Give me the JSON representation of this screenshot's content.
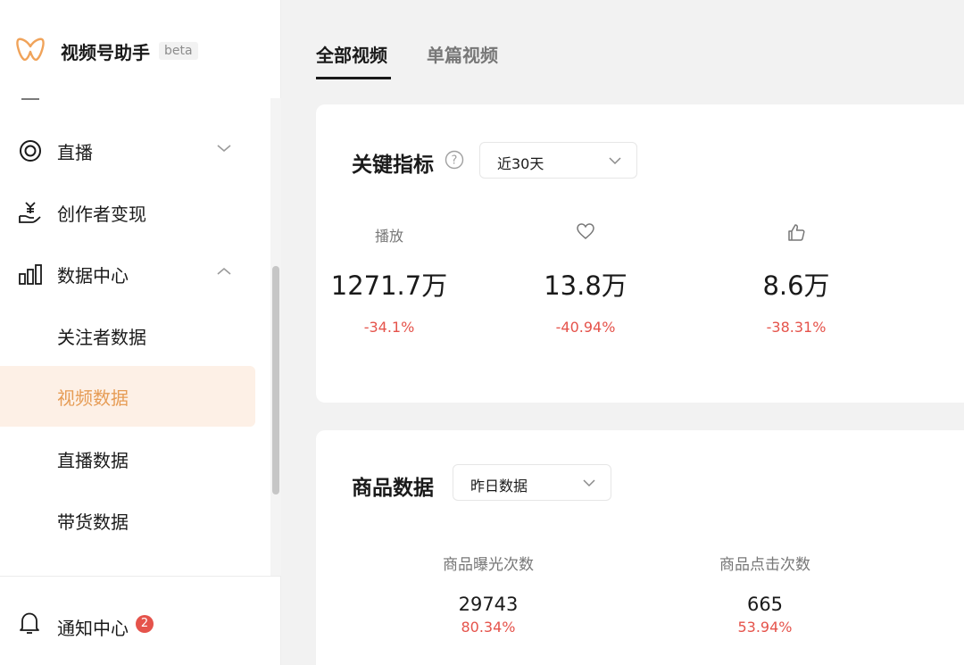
{
  "brand": {
    "title": "视频号助手",
    "beta": "beta",
    "logo_icon": "butterfly-logo-icon",
    "accent": "#f0a35a"
  },
  "sidebar": {
    "items": [
      {
        "label": "直播",
        "icon": "live-ring-icon",
        "expand": "chevron-down-icon"
      },
      {
        "label": "创作者变现",
        "icon": "money-hand-icon"
      },
      {
        "label": "数据中心",
        "icon": "bar-chart-icon",
        "expand": "chevron-up-icon"
      },
      {
        "label": "关注者数据"
      },
      {
        "label": "视频数据",
        "active": true
      },
      {
        "label": "直播数据"
      },
      {
        "label": "带货数据"
      }
    ],
    "notice": {
      "label": "通知中心",
      "icon": "bell-icon",
      "badge": "2"
    }
  },
  "tabs": [
    {
      "label": "全部视频",
      "active": true
    },
    {
      "label": "单篇视频",
      "active": false
    }
  ],
  "key_metrics": {
    "title": "关键指标",
    "help_icon": "question-circle-icon",
    "range": "近30天",
    "items": [
      {
        "label": "播放",
        "value": "1271.7万",
        "change": "-34.1%"
      },
      {
        "icon": "heart-icon",
        "value": "13.8万",
        "change": "-40.94%"
      },
      {
        "icon": "thumbs-up-icon",
        "value": "8.6万",
        "change": "-38.31%"
      }
    ]
  },
  "goods": {
    "title": "商品数据",
    "range": "昨日数据",
    "items": [
      {
        "label": "商品曝光次数",
        "value": "29743",
        "change": "80.34%"
      },
      {
        "label": "商品点击次数",
        "value": "665",
        "change": "53.94%"
      }
    ]
  },
  "colors": {
    "negative": "#e5534b",
    "active_bg": "#fdf0e6",
    "active_text": "#e69c55"
  }
}
